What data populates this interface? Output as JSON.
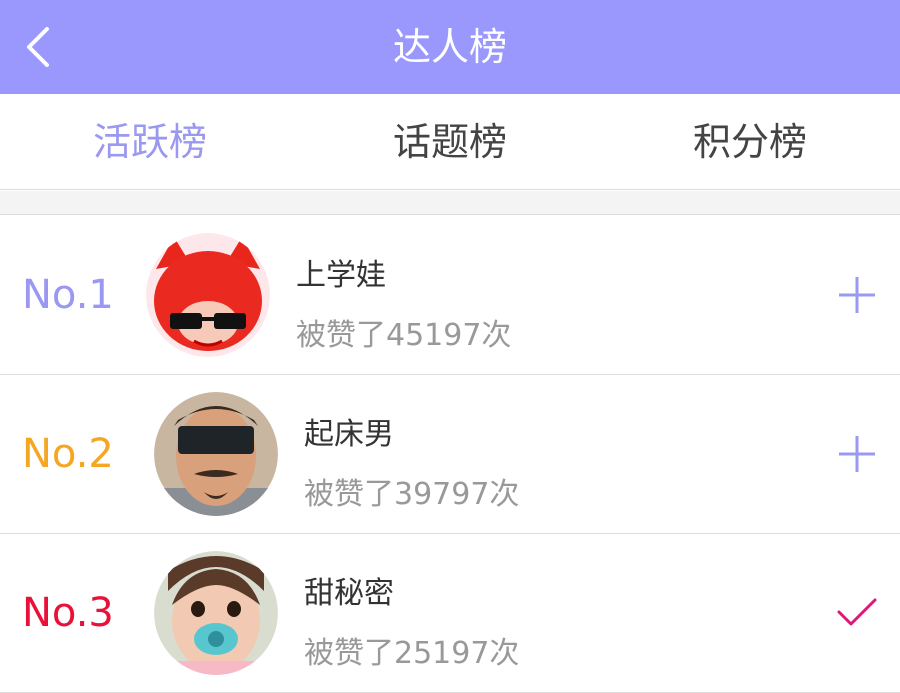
{
  "header": {
    "title": "达人榜",
    "back_icon": "back-chevron-icon"
  },
  "tabs": [
    {
      "label": "活跃榜",
      "active": true
    },
    {
      "label": "话题榜",
      "active": false
    },
    {
      "label": "积分榜",
      "active": false
    }
  ],
  "colors": {
    "accent": "#9a98fd",
    "rank_1": "#9a98f0",
    "rank_2": "#f5a623",
    "rank_3": "#e8113a",
    "check": "#e0147a"
  },
  "rankings": [
    {
      "rank": "No.1",
      "name": "上学娃",
      "likes": "被赞了45197次",
      "action": "plus-icon",
      "following": false
    },
    {
      "rank": "No.2",
      "name": "起床男",
      "likes": "被赞了39797次",
      "action": "plus-icon",
      "following": false
    },
    {
      "rank": "No.3",
      "name": "甜秘密",
      "likes": "被赞了25197次",
      "action": "check-icon",
      "following": true
    }
  ]
}
